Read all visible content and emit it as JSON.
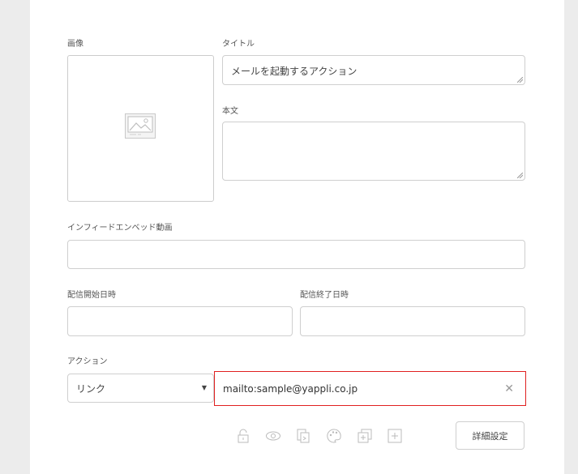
{
  "labels": {
    "image": "画像",
    "title": "タイトル",
    "body": "本文",
    "infeed": "インフィードエンベッド動画",
    "start": "配信開始日時",
    "end": "配信終了日時",
    "action": "アクション"
  },
  "fields": {
    "title_value": "メールを起動するアクション",
    "body_value": "",
    "infeed_value": "",
    "start_value": "",
    "end_value": ""
  },
  "action": {
    "type_selected": "リンク",
    "url_value": "mailto:sample@yappli.co.jp"
  },
  "toolbar": {
    "icons": [
      "lock-icon",
      "eye-icon",
      "copy-icon",
      "palette-icon",
      "duplicate-icon",
      "add-icon"
    ],
    "detail_label": "詳細設定"
  }
}
